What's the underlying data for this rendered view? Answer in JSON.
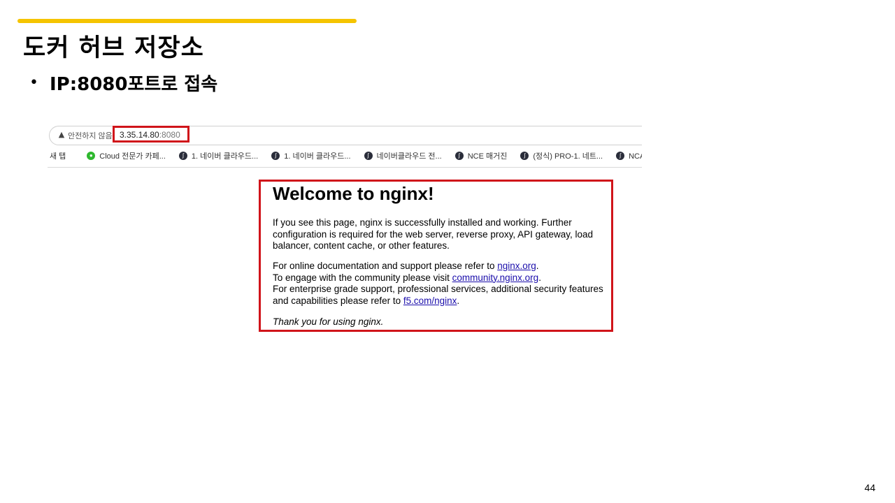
{
  "slide": {
    "title": "도커 허브 저장소",
    "bullet_marker": "•",
    "bullet": "IP:8080포트로 접속",
    "page_number": "44",
    "accent_color": "#f5c400",
    "highlight_color": "#d0141a"
  },
  "browser": {
    "warning_icon": "warning-triangle-icon",
    "insecure_label": "안전하지 않음",
    "url_host": "3.35.14.80",
    "url_port": ":8080",
    "bookmarks": [
      {
        "label": "새 탭",
        "icon": ""
      },
      {
        "label": "Cloud 전문가 카페...",
        "icon": "leaf-icon"
      },
      {
        "label": "1. 네이버 클라우드...",
        "icon": "feather-icon"
      },
      {
        "label": "1. 네이버 클라우드...",
        "icon": "feather-icon"
      },
      {
        "label": "네이버클라우드 전...",
        "icon": "feather-icon"
      },
      {
        "label": "NCE 매거진",
        "icon": "feather-icon"
      },
      {
        "label": "(정식) PRO-1. 네트...",
        "icon": "feather-icon"
      },
      {
        "label": "NCA 매거진",
        "icon": "feather-icon"
      }
    ]
  },
  "nginx": {
    "title": "Welcome to nginx!",
    "p1": "If you see this page, nginx is successfully installed and working. Further configuration is required for the web server, reverse proxy, API gateway, load balancer, content cache, or other features.",
    "p2_a": "For online documentation and support please refer to ",
    "p2_link1": "nginx.org",
    "p2_b": ".",
    "p2_c": "To engage with the community please visit ",
    "p2_link2": "community.nginx.org",
    "p2_d": ".",
    "p2_e": "For enterprise grade support, professional services, additional security features and capabilities please refer to ",
    "p2_link3": "f5.com/nginx",
    "p2_f": ".",
    "p3": "Thank you for using nginx."
  }
}
